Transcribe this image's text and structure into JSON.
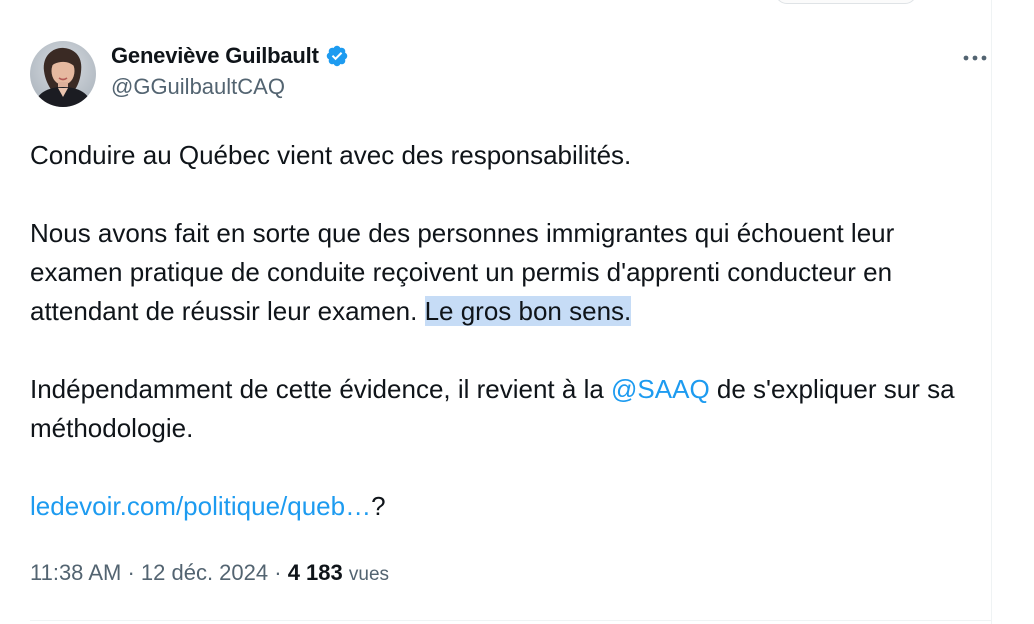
{
  "tweet": {
    "author": {
      "display_name": "Geneviève Guilbault",
      "handle": "@GGuilbaultCAQ",
      "verified_icon": "verified-badge-icon",
      "avatar_icon": "profile-photo"
    },
    "more_icon": "more-options-icon",
    "body": {
      "p1": "Conduire au Québec vient avec des responsabilités.",
      "p2_text": "Nous avons fait en sorte que des personnes immigrantes qui échouent leur examen pratique de conduite reçoivent un permis d'apprenti conducteur en attendant de réussir leur examen. ",
      "p2_highlight": "Le gros bon sens.",
      "p3_before": "Indépendamment de cette évidence, il revient à la ",
      "p3_mention": "@SAAQ",
      "p3_after": " de s'expliquer sur sa méthodologie.",
      "p4_link": "ledevoir.com/politique/queb…",
      "p4_after": "?"
    },
    "meta": {
      "time": "11:38 AM",
      "sep1": " · ",
      "date": "12 déc. 2024",
      "sep2": " · ",
      "views_count": "4 183",
      "views_label": "vues"
    }
  },
  "colors": {
    "link": "#1d9bf0",
    "highlight": "#c6dcf6",
    "secondary_text": "#536471",
    "primary_text": "#0f1419",
    "verified": "#1d9bf0"
  }
}
